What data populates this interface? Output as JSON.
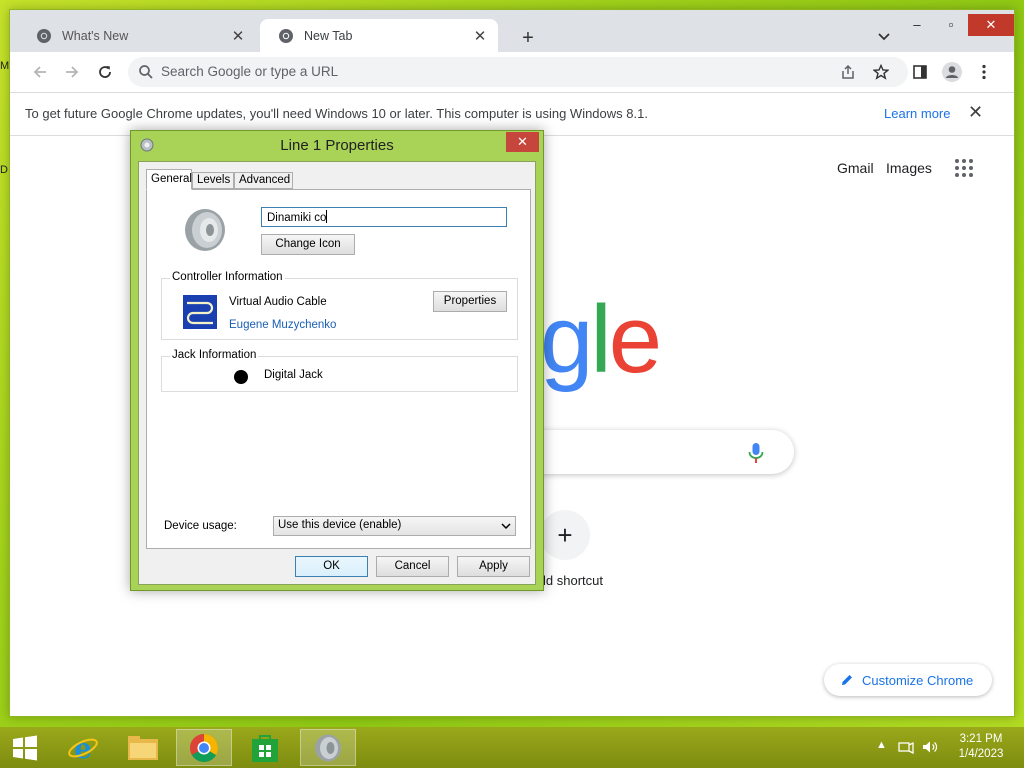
{
  "desktop": {
    "frag_1": "M",
    "frag_2": "D"
  },
  "chrome": {
    "tabs": [
      {
        "title": "What's New",
        "close": "✕"
      },
      {
        "title": "New Tab",
        "close": "✕"
      }
    ],
    "new_tab": "+",
    "window_controls": {
      "minimize": "–",
      "maximize": "▫",
      "close": "✕"
    },
    "omnibox_placeholder": "Search Google or type a URL",
    "infobar": {
      "message": "To get future Google Chrome updates, you'll need Windows 10 or later. This computer is using Windows 8.1.",
      "link": "Learn more",
      "close": "✕"
    },
    "ntp": {
      "gmail": "Gmail",
      "images": "Images",
      "logo_part": [
        "g",
        "l",
        "e"
      ],
      "logo_colors": [
        "#4285f4",
        "#34a853",
        "#ea4335"
      ],
      "shortcut_plus": "+",
      "shortcut_label": "ld shortcut",
      "customize": "Customize Chrome"
    }
  },
  "dialog": {
    "title": "Line 1 Properties",
    "close": "✕",
    "tabs": [
      "General",
      "Levels",
      "Advanced"
    ],
    "name_value": "Dinamiki co",
    "change_icon": "Change Icon",
    "controller": {
      "label": "Controller Information",
      "name": "Virtual Audio Cable",
      "vendor": "Eugene Muzychenko",
      "properties": "Properties"
    },
    "jack": {
      "label": "Jack Information",
      "name": "Digital Jack"
    },
    "device_usage_label": "Device usage:",
    "device_usage_value": "Use this device (enable)",
    "buttons": {
      "ok": "OK",
      "cancel": "Cancel",
      "apply": "Apply"
    }
  },
  "taskbar": {
    "items": [
      "start-icon",
      "ie-icon",
      "explorer-icon",
      "chrome-icon",
      "store-icon",
      "speaker-app-icon"
    ],
    "tray_arrow": "▲",
    "time": "3:21 PM",
    "date": "1/4/2023"
  }
}
